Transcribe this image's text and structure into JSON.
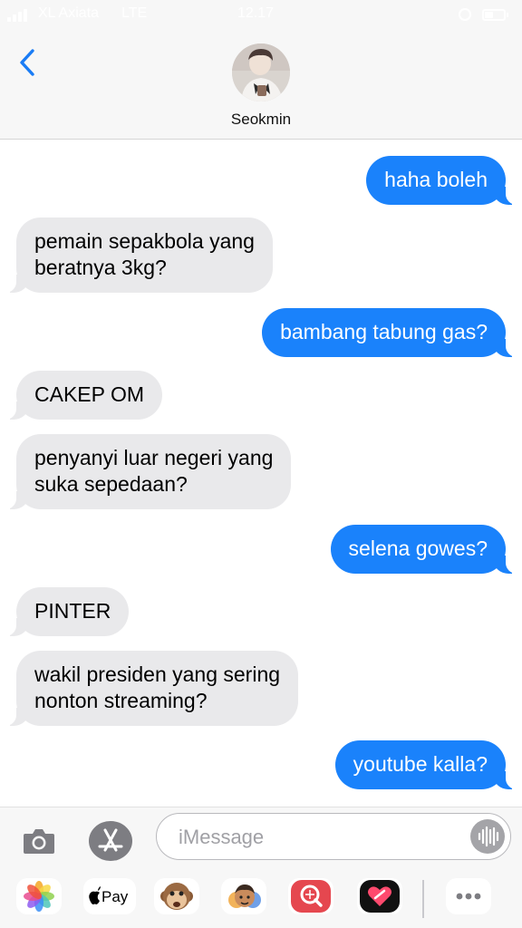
{
  "status_bar": {
    "carrier": "XL Axiata",
    "network": "LTE",
    "time": "12.17"
  },
  "header": {
    "contact_name": "Seokmin"
  },
  "messages": [
    {
      "direction": "outgoing",
      "lines": [
        "haha boleh"
      ]
    },
    {
      "direction": "incoming",
      "lines": [
        "pemain sepakbola yang",
        "beratnya 3kg?"
      ]
    },
    {
      "direction": "outgoing",
      "lines": [
        "bambang tabung gas?"
      ]
    },
    {
      "direction": "incoming",
      "lines": [
        "CAKEP OM"
      ]
    },
    {
      "direction": "incoming",
      "lines": [
        "penyanyi luar negeri yang",
        "suka sepedaan?"
      ]
    },
    {
      "direction": "outgoing",
      "lines": [
        "selena gowes?"
      ]
    },
    {
      "direction": "incoming",
      "lines": [
        "PINTER"
      ]
    },
    {
      "direction": "incoming",
      "lines": [
        "wakil presiden yang sering",
        "nonton streaming?"
      ]
    },
    {
      "direction": "outgoing",
      "lines": [
        "youtube kalla?"
      ]
    }
  ],
  "composer": {
    "placeholder": "iMessage"
  },
  "app_drawer": {
    "items": [
      "photos-icon",
      "apple-pay-icon",
      "monkey-animoji-icon",
      "memoji-icon",
      "image-search-icon",
      "digital-touch-icon",
      "more-icon"
    ],
    "apple_pay_label": "Pay"
  },
  "colors": {
    "outgoing_bubble": "#1a82fb",
    "incoming_bubble": "#e9e9eb",
    "accent": "#1a7cf5"
  }
}
